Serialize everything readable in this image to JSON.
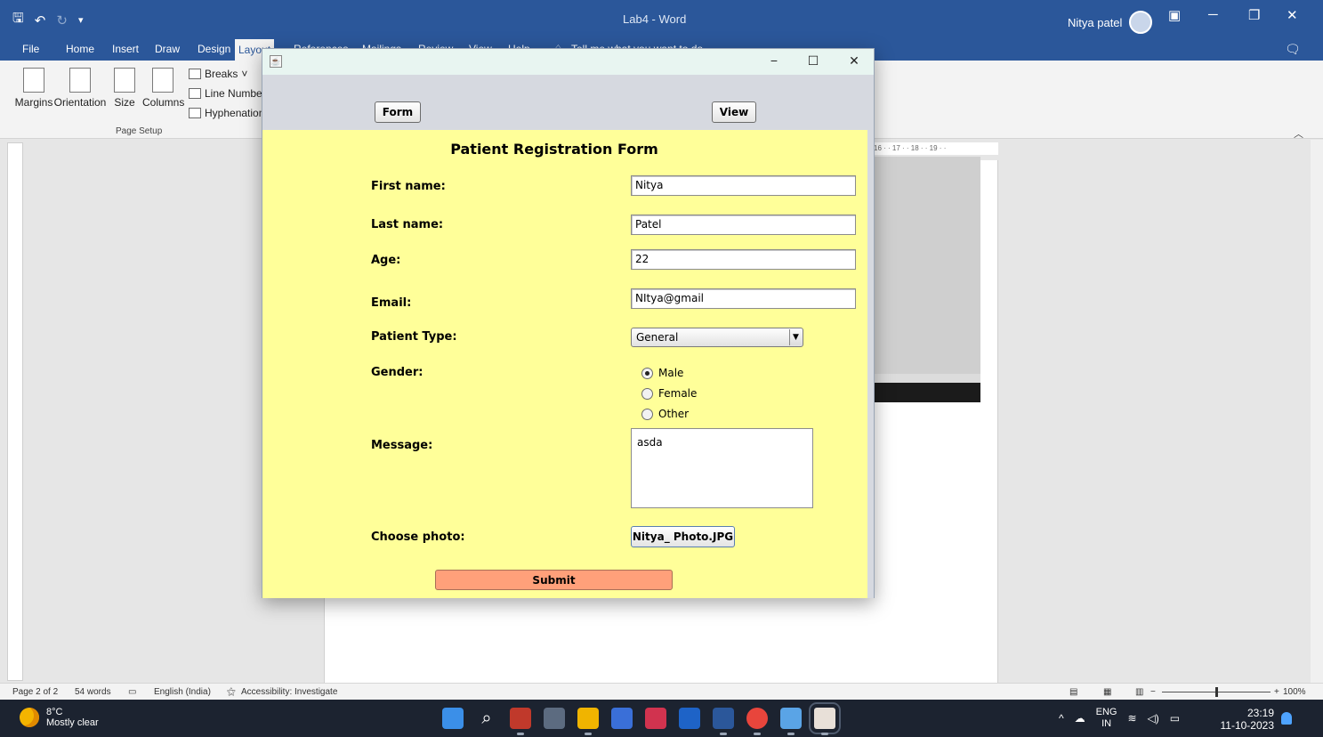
{
  "word": {
    "doc_title": "Lab4 - Word",
    "user_name": "Nitya patel",
    "tabs": [
      "File",
      "Home",
      "Insert",
      "Draw",
      "Design",
      "Layout",
      "References",
      "Mailings",
      "Review",
      "View",
      "Help"
    ],
    "tell_me": "Tell me what you want to do",
    "ribbon": {
      "margins": "Margins",
      "orientation": "Orientation",
      "size": "Size",
      "columns": "Columns",
      "breaks": "Breaks",
      "line_numbers": "Line Numbers",
      "hyphenation": "Hyphenation",
      "group_label": "Page Setup"
    },
    "ruler_text": "16 · · 17 · · 18 · · 19 · ·",
    "status": {
      "page": "Page 2 of 2",
      "words": "54 words",
      "language": "English (India)",
      "accessibility": "Accessibility: Investigate",
      "zoom": "100%"
    }
  },
  "java_window": {
    "nav": {
      "form_label": "Form",
      "view_label": "View"
    },
    "form": {
      "title": "Patient Registration Form",
      "first_name_label": "First name:",
      "first_name_value": "Nitya",
      "last_name_label": "Last name:",
      "last_name_value": "Patel",
      "age_label": "Age:",
      "age_value": "22",
      "email_label": "Email:",
      "email_value": "NItya@gmail",
      "patient_type_label": "Patient Type:",
      "patient_type_value": "General",
      "gender_label": "Gender:",
      "gender_options": [
        "Male",
        "Female",
        "Other"
      ],
      "gender_selected": "Male",
      "message_label": "Message:",
      "message_value": "asda",
      "photo_label": "Choose photo:",
      "photo_button": "Nitya_ Photo.JPG",
      "submit_label": "Submit"
    }
  },
  "taskbar": {
    "temperature": "8°C",
    "weather": "Mostly clear",
    "lang_top": "ENG",
    "lang_bottom": "IN",
    "time": "23:19",
    "date": "11-10-2023"
  },
  "colors": {
    "word_blue": "#2b579a",
    "form_bg": "#ffff99",
    "submit_bg": "#ffa07a",
    "taskbar_bg": "#1c2330"
  }
}
